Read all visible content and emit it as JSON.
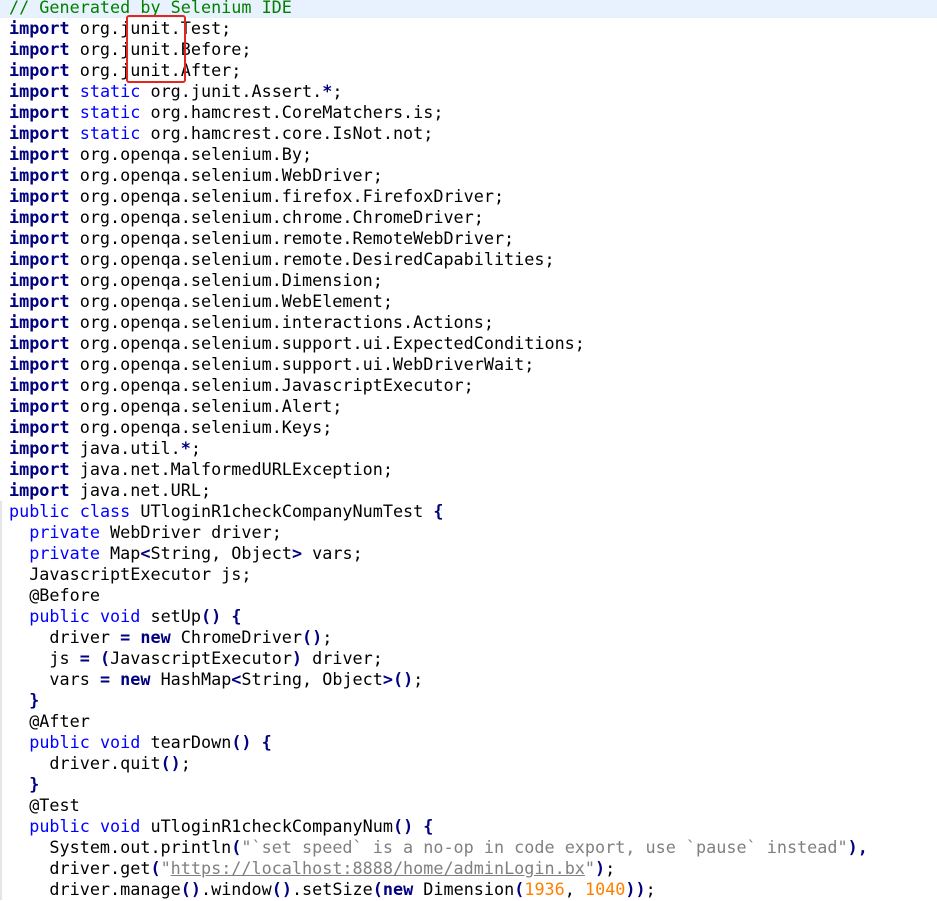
{
  "editor": {
    "highlight_color": "#e5261f",
    "token_colors": {
      "keyword": "#000080",
      "modifier": "#0000ff",
      "string": "#808080",
      "number": "#ff8000",
      "comment": "#008000"
    },
    "lines": [
      [
        [
          "com",
          "// Generated by Selenium IDE"
        ]
      ],
      [
        [
          "kw",
          "import"
        ],
        [
          "plain",
          " org.junit.Test;"
        ]
      ],
      [
        [
          "kw",
          "import"
        ],
        [
          "plain",
          " org.junit.Before;"
        ]
      ],
      [
        [
          "kw",
          "import"
        ],
        [
          "plain",
          " org.junit.After;"
        ]
      ],
      [
        [
          "kw",
          "import"
        ],
        [
          "plain",
          " "
        ],
        [
          "mod",
          "static"
        ],
        [
          "plain",
          " org.junit.Assert."
        ],
        [
          "op",
          "*"
        ],
        [
          "plain",
          ";"
        ]
      ],
      [
        [
          "kw",
          "import"
        ],
        [
          "plain",
          " "
        ],
        [
          "mod",
          "static"
        ],
        [
          "plain",
          " org.hamcrest.CoreMatchers.is;"
        ]
      ],
      [
        [
          "kw",
          "import"
        ],
        [
          "plain",
          " "
        ],
        [
          "mod",
          "static"
        ],
        [
          "plain",
          " org.hamcrest.core.IsNot.not;"
        ]
      ],
      [
        [
          "kw",
          "import"
        ],
        [
          "plain",
          " org.openqa.selenium.By;"
        ]
      ],
      [
        [
          "kw",
          "import"
        ],
        [
          "plain",
          " org.openqa.selenium.WebDriver;"
        ]
      ],
      [
        [
          "kw",
          "import"
        ],
        [
          "plain",
          " org.openqa.selenium.firefox.FirefoxDriver;"
        ]
      ],
      [
        [
          "kw",
          "import"
        ],
        [
          "plain",
          " org.openqa.selenium.chrome.ChromeDriver;"
        ]
      ],
      [
        [
          "kw",
          "import"
        ],
        [
          "plain",
          " org.openqa.selenium.remote.RemoteWebDriver;"
        ]
      ],
      [
        [
          "kw",
          "import"
        ],
        [
          "plain",
          " org.openqa.selenium.remote.DesiredCapabilities;"
        ]
      ],
      [
        [
          "kw",
          "import"
        ],
        [
          "plain",
          " org.openqa.selenium.Dimension;"
        ]
      ],
      [
        [
          "kw",
          "import"
        ],
        [
          "plain",
          " org.openqa.selenium.WebElement;"
        ]
      ],
      [
        [
          "kw",
          "import"
        ],
        [
          "plain",
          " org.openqa.selenium.interactions.Actions;"
        ]
      ],
      [
        [
          "kw",
          "import"
        ],
        [
          "plain",
          " org.openqa.selenium.support.ui.ExpectedConditions;"
        ]
      ],
      [
        [
          "kw",
          "import"
        ],
        [
          "plain",
          " org.openqa.selenium.support.ui.WebDriverWait;"
        ]
      ],
      [
        [
          "kw",
          "import"
        ],
        [
          "plain",
          " org.openqa.selenium.JavascriptExecutor;"
        ]
      ],
      [
        [
          "kw",
          "import"
        ],
        [
          "plain",
          " org.openqa.selenium.Alert;"
        ]
      ],
      [
        [
          "kw",
          "import"
        ],
        [
          "plain",
          " org.openqa.selenium.Keys;"
        ]
      ],
      [
        [
          "kw",
          "import"
        ],
        [
          "plain",
          " java.util."
        ],
        [
          "op",
          "*"
        ],
        [
          "plain",
          ";"
        ]
      ],
      [
        [
          "kw",
          "import"
        ],
        [
          "plain",
          " java.net.MalformedURLException;"
        ]
      ],
      [
        [
          "kw",
          "import"
        ],
        [
          "plain",
          " java.net.URL;"
        ]
      ],
      [
        [
          "mod",
          "public"
        ],
        [
          "plain",
          " "
        ],
        [
          "mod",
          "class"
        ],
        [
          "plain",
          " UTloginR1checkCompanyNumTest "
        ],
        [
          "op",
          "{"
        ]
      ],
      [
        [
          "plain",
          "  "
        ],
        [
          "mod",
          "private"
        ],
        [
          "plain",
          " WebDriver driver;"
        ]
      ],
      [
        [
          "plain",
          "  "
        ],
        [
          "mod",
          "private"
        ],
        [
          "plain",
          " Map"
        ],
        [
          "op",
          "<"
        ],
        [
          "plain",
          "String, Object"
        ],
        [
          "op",
          ">"
        ],
        [
          "plain",
          " vars;"
        ]
      ],
      [
        [
          "plain",
          "  JavascriptExecutor js;"
        ]
      ],
      [
        [
          "plain",
          "  @Before"
        ]
      ],
      [
        [
          "plain",
          "  "
        ],
        [
          "mod",
          "public"
        ],
        [
          "plain",
          " "
        ],
        [
          "mod",
          "void"
        ],
        [
          "plain",
          " setUp"
        ],
        [
          "op",
          "()"
        ],
        [
          "plain",
          " "
        ],
        [
          "op",
          "{"
        ]
      ],
      [
        [
          "plain",
          "    driver "
        ],
        [
          "op",
          "="
        ],
        [
          "plain",
          " "
        ],
        [
          "kw",
          "new"
        ],
        [
          "plain",
          " ChromeDriver"
        ],
        [
          "op",
          "()"
        ],
        [
          "plain",
          ";"
        ]
      ],
      [
        [
          "plain",
          "    js "
        ],
        [
          "op",
          "="
        ],
        [
          "plain",
          " "
        ],
        [
          "op",
          "("
        ],
        [
          "plain",
          "JavascriptExecutor"
        ],
        [
          "op",
          ")"
        ],
        [
          "plain",
          " driver;"
        ]
      ],
      [
        [
          "plain",
          "    vars "
        ],
        [
          "op",
          "="
        ],
        [
          "plain",
          " "
        ],
        [
          "kw",
          "new"
        ],
        [
          "plain",
          " HashMap"
        ],
        [
          "op",
          "<"
        ],
        [
          "plain",
          "String, Object"
        ],
        [
          "op",
          ">()"
        ],
        [
          "plain",
          ";"
        ]
      ],
      [
        [
          "plain",
          "  "
        ],
        [
          "op",
          "}"
        ]
      ],
      [
        [
          "plain",
          "  @After"
        ]
      ],
      [
        [
          "plain",
          "  "
        ],
        [
          "mod",
          "public"
        ],
        [
          "plain",
          " "
        ],
        [
          "mod",
          "void"
        ],
        [
          "plain",
          " tearDown"
        ],
        [
          "op",
          "()"
        ],
        [
          "plain",
          " "
        ],
        [
          "op",
          "{"
        ]
      ],
      [
        [
          "plain",
          "    driver.quit"
        ],
        [
          "op",
          "()"
        ],
        [
          "plain",
          ";"
        ]
      ],
      [
        [
          "plain",
          "  "
        ],
        [
          "op",
          "}"
        ]
      ],
      [
        [
          "plain",
          "  @Test"
        ]
      ],
      [
        [
          "plain",
          "  "
        ],
        [
          "mod",
          "public"
        ],
        [
          "plain",
          " "
        ],
        [
          "mod",
          "void"
        ],
        [
          "plain",
          " uTloginR1checkCompanyNum"
        ],
        [
          "op",
          "()"
        ],
        [
          "plain",
          " "
        ],
        [
          "op",
          "{"
        ]
      ],
      [
        [
          "plain",
          "    System.out.println"
        ],
        [
          "op",
          "("
        ],
        [
          "str",
          "\"`set speed` is a no-op in code export, use `pause` instead\""
        ],
        [
          "op",
          "),"
        ]
      ],
      [
        [
          "plain",
          "    driver.get"
        ],
        [
          "op",
          "("
        ],
        [
          "str",
          "\""
        ],
        [
          "url",
          "https://localhost:8888/home/adminLogin.bx"
        ],
        [
          "str",
          "\""
        ],
        [
          "op",
          ")"
        ],
        [
          "plain",
          ";"
        ]
      ],
      [
        [
          "plain",
          "    driver.manage"
        ],
        [
          "op",
          "()"
        ],
        [
          "plain",
          ".window"
        ],
        [
          "op",
          "()"
        ],
        [
          "plain",
          ".setSize"
        ],
        [
          "op",
          "("
        ],
        [
          "kw",
          "new"
        ],
        [
          "plain",
          " Dimension"
        ],
        [
          "op",
          "("
        ],
        [
          "num",
          "1936"
        ],
        [
          "plain",
          ", "
        ],
        [
          "num",
          "1040"
        ],
        [
          "op",
          "))"
        ],
        [
          "plain",
          ";"
        ]
      ]
    ]
  }
}
